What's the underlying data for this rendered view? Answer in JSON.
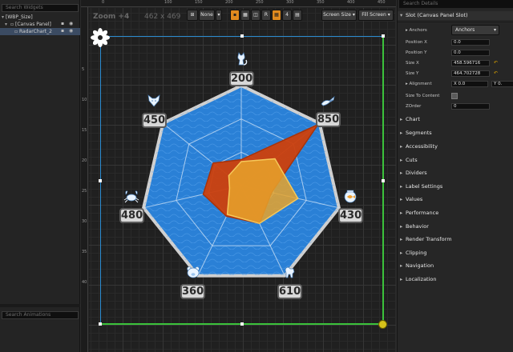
{
  "hierarchy": {
    "search_placeholder": "Search Widgets",
    "items": [
      {
        "label": "[WBP_Size]"
      },
      {
        "label": "[Canvas Panel]"
      },
      {
        "label": "RadarChart_2"
      }
    ],
    "animations_placeholder": "Search Animations"
  },
  "designer": {
    "zoom_label": "Zoom +4",
    "dimensions": "462 x 469",
    "ruler_top": [
      "0",
      "100",
      "150",
      "200",
      "250",
      "300",
      "350",
      "400",
      "450"
    ],
    "ruler_left": [
      "5",
      "10",
      "15",
      "20",
      "25",
      "30",
      "35",
      "40"
    ],
    "toolbar": {
      "none_label": "None",
      "r_label": "R",
      "four_label": "4",
      "screen_size_label": "Screen Size",
      "fill_screen_label": "Fill Screen"
    }
  },
  "chart_data": {
    "type": "radar",
    "categories": [
      "cat",
      "crocodile",
      "fish",
      "dog",
      "bear",
      "crab",
      "wolf"
    ],
    "labels": [
      "200",
      "850",
      "430",
      "610",
      "360",
      "480",
      "450"
    ],
    "series": [
      {
        "values": [
          0.26,
          0.98,
          0.31,
          0.42,
          0.34,
          0.39,
          0.36
        ],
        "color": "#cc3f0c"
      },
      {
        "values": [
          0.24,
          0.43,
          0.58,
          0.42,
          0.32,
          0.12,
          0.16
        ],
        "color": "#e8a32c"
      }
    ],
    "background_color": "#2a80d6",
    "outline_color": "#d0d0d0",
    "rings": 2
  },
  "details": {
    "search_placeholder": "Search Details",
    "slot_title": "Slot (Canvas Panel Slot)",
    "anchors_label": "Anchors",
    "anchors_value": "Anchors",
    "position_x_label": "Position X",
    "position_x_value": "0.0",
    "position_y_label": "Position Y",
    "position_y_value": "0.0",
    "size_x_label": "Size X",
    "size_x_value": "458.596716",
    "size_y_label": "Size Y",
    "size_y_value": "464.702728",
    "alignment_label": "Alignment",
    "alignment_x_label": "X",
    "alignment_x_value": "0.0",
    "alignment_y_label": "Y",
    "alignment_y_value": "0.",
    "size_to_content_label": "Size To Content",
    "zorder_label": "ZOrder",
    "zorder_value": "0",
    "sections": [
      "Chart",
      "Segments",
      "Accessibility",
      "Cuts",
      "Dividers",
      "Label Settings",
      "Values",
      "Performance",
      "Behavior",
      "Render Transform",
      "Clipping",
      "Navigation",
      "Localization"
    ]
  },
  "colors": {
    "selection": "#3b4b62",
    "canvas_outline": "#2b8bd0",
    "canvas_resize": "#3bc23b",
    "toolbar_accent": "#e08a1e"
  }
}
